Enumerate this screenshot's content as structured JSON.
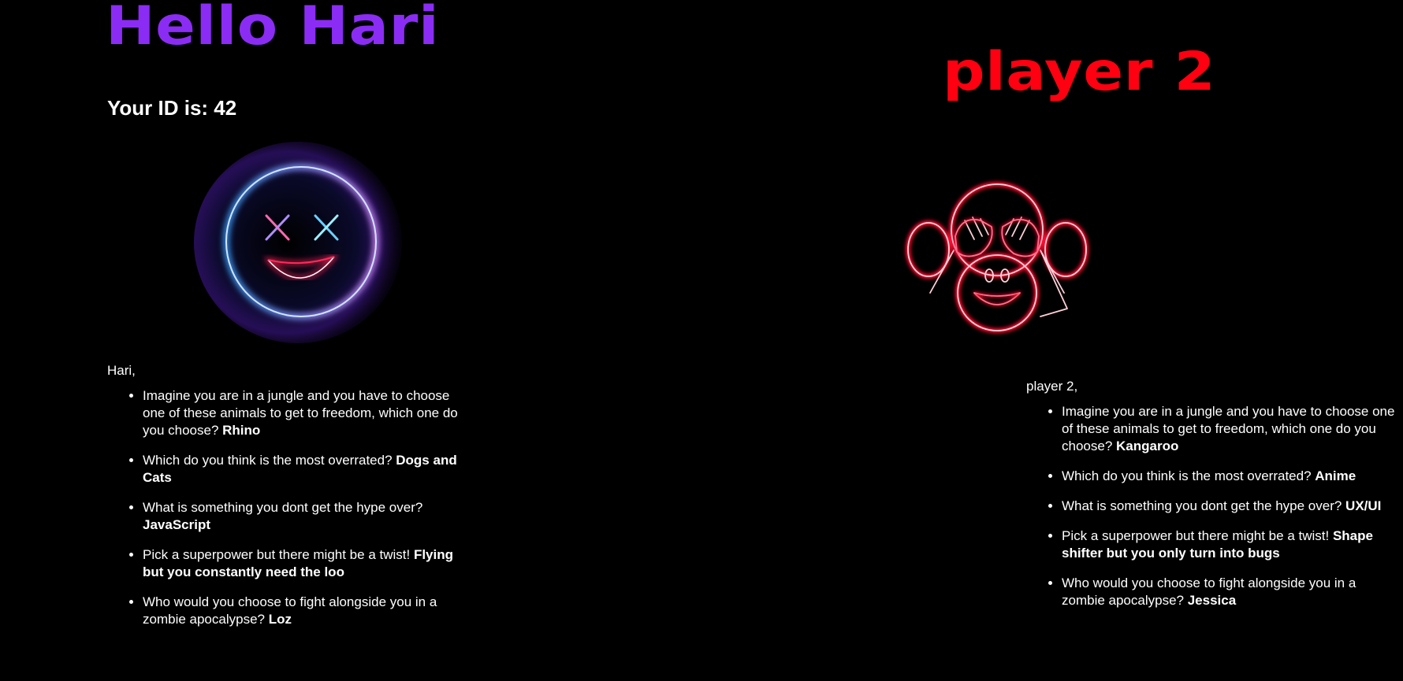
{
  "player1": {
    "title": "Hello Hari",
    "id_label": "Your ID is: 42",
    "avatar_icon": "neon-x-eyes-smiley-icon",
    "greeting": "Hari,",
    "answers": [
      {
        "question": "Imagine you are in a jungle and you have to choose one of these animals to get to freedom, which one do you choose? ",
        "answer": "Rhino"
      },
      {
        "question": "Which do you think is the most overrated? ",
        "answer": "Dogs and Cats"
      },
      {
        "question": "What is something you dont get the hype over? ",
        "answer": "JavaScript"
      },
      {
        "question": "Pick a superpower but there might be a twist! ",
        "answer": "Flying but you constantly need the loo"
      },
      {
        "question": "Who would you choose to fight alongside you in a zombie apocalypse? ",
        "answer": "Loz"
      }
    ]
  },
  "player2": {
    "title": "player 2",
    "avatar_icon": "neon-see-no-evil-monkey-icon",
    "greeting": "player 2,",
    "answers": [
      {
        "question": "Imagine you are in a jungle and you have to choose one of these animals to get to freedom, which one do you choose? ",
        "answer": "Kangaroo"
      },
      {
        "question": "Which do you think is the most overrated? ",
        "answer": "Anime"
      },
      {
        "question": "What is something you dont get the hype over? ",
        "answer": "UX/UI"
      },
      {
        "question": "Pick a superpower but there might be a twist! ",
        "answer": "Shape shifter but you only turn into bugs"
      },
      {
        "question": "Who would you choose to fight alongside you in a zombie apocalypse? ",
        "answer": "Jessica"
      }
    ]
  },
  "colors": {
    "player1_title": "#8b2cf5",
    "player2_title": "#ff0010",
    "background": "#000000",
    "text": "#ffffff"
  }
}
